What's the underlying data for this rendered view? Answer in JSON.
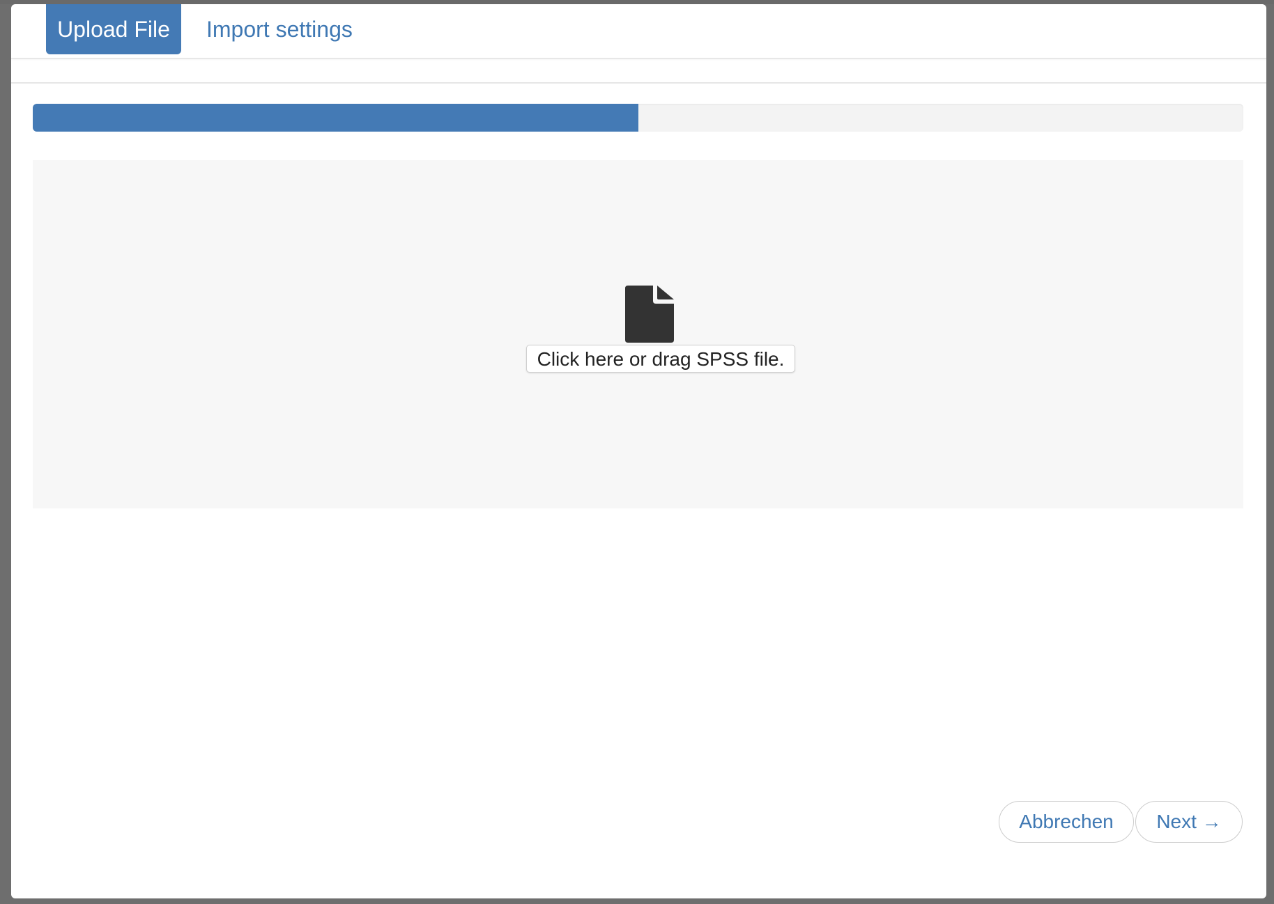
{
  "tabs": [
    {
      "label": "Upload File",
      "active": true
    },
    {
      "label": "Import settings",
      "active": false
    }
  ],
  "progress": {
    "fraction": 0.5
  },
  "dropzone": {
    "icon": "file-icon",
    "label": "Click here or drag SPSS file."
  },
  "footer": {
    "cancel_label": "Abbrechen",
    "next_label": "Next →"
  },
  "colors": {
    "accent": "#447ab5",
    "link": "#3f78b3",
    "icon": "#333333"
  }
}
